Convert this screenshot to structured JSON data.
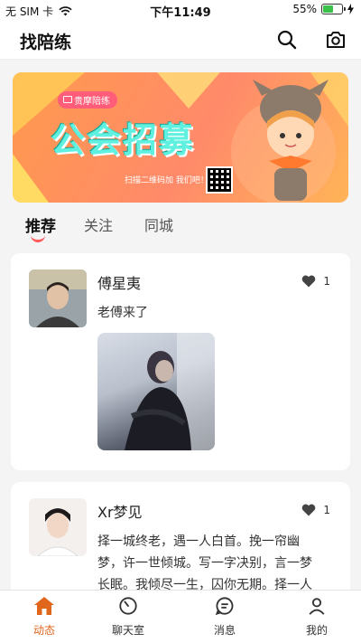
{
  "status_bar": {
    "carrier": "无 SIM 卡",
    "time": "下午11:49",
    "battery_percent": "55%",
    "battery_level": 0.55
  },
  "header": {
    "title": "找陪练",
    "icons": [
      "search-icon",
      "camera-icon"
    ]
  },
  "banner": {
    "badge": "贵摩陪练",
    "title": "公会招募",
    "note": "扫描二维码加 我们吧！"
  },
  "tabs": [
    {
      "label": "推荐",
      "active": true
    },
    {
      "label": "关注",
      "active": false
    },
    {
      "label": "同城",
      "active": false
    }
  ],
  "posts": [
    {
      "username": "傅星夷",
      "likes": "1",
      "text": "老傅来了",
      "has_image": true
    },
    {
      "username": "Xr梦见",
      "likes": "1",
      "text_lines": [
        "择一城终老，遇一人白首。挽一帘幽",
        "梦，许一世倾城。写一字决别，言一梦",
        "长眠。我倾尽一生，囚你无期。择一人"
      ]
    }
  ],
  "bottom_nav": [
    {
      "label": "动态",
      "active": true,
      "icon": "home-icon"
    },
    {
      "label": "聊天室",
      "active": false,
      "icon": "clock-icon"
    },
    {
      "label": "消息",
      "active": false,
      "icon": "message-icon"
    },
    {
      "label": "我的",
      "active": false,
      "icon": "profile-icon"
    }
  ],
  "colors": {
    "accent": "#e0661c",
    "tab_indicator": "#ff5b5b",
    "banner_title": "#5ff0e0"
  }
}
